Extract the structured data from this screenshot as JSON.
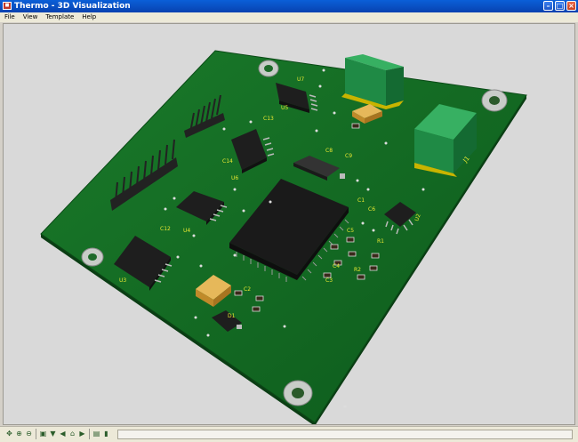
{
  "window": {
    "title": "Thermo - 3D Visualization",
    "icon": "app-logo-icon"
  },
  "menu": [
    "File",
    "View",
    "Template",
    "Help"
  ],
  "board": {
    "refdes": {
      "u5": "U5",
      "u6": "U6",
      "u4": "U4",
      "u3": "U3",
      "u2": "U2",
      "c13": "C13",
      "c14": "C14",
      "c12": "C12",
      "c8": "C8",
      "c9": "C9",
      "c1": "C1",
      "c3": "C3",
      "c6": "C6",
      "c4": "C4",
      "c5": "C5",
      "c2": "C2",
      "r1": "R1",
      "r2": "R2",
      "d1": "D1",
      "j1": "J1",
      "u7": "U7"
    }
  },
  "toolbar": {
    "icons": [
      "pan-icon",
      "zoom-in-icon",
      "zoom-out-icon",
      "fit-icon",
      "filter-icon",
      "rotate-left-icon",
      "home-icon",
      "rotate-right-icon",
      "camera-icon",
      "layers-icon",
      "board-icon"
    ]
  }
}
